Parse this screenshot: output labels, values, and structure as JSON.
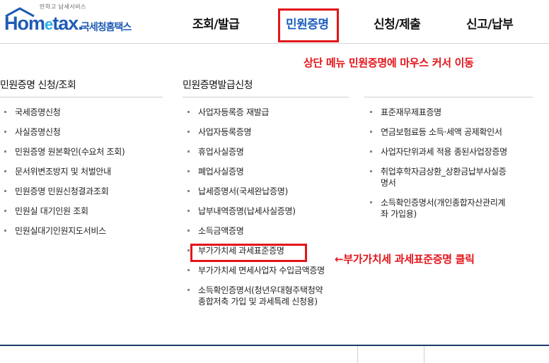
{
  "header": {
    "logo_small_text": "만하고 납세서비스",
    "logo_brand_home": "Hom",
    "logo_brand_e": "e",
    "logo_brand_tax": "tax.",
    "logo_korean_name": "국세청홈택스",
    "nav": [
      {
        "label": "조회/발급"
      },
      {
        "label": "민원증명"
      },
      {
        "label": "신청/제출"
      },
      {
        "label": "신고/납부"
      }
    ]
  },
  "annotations": {
    "top": "상단 메뉴 민원증명에 마우스 커서 이동",
    "click": "←부가가치세 과세표준증명 클릭"
  },
  "columns": {
    "col1": {
      "title": "민원증명 신청/조회",
      "items": [
        "국세증명신청",
        "사실증명신청",
        "민원증명 원본확인(수요처 조회)",
        "문서위변조방지 및 처벌안내",
        "민원증명 민원신청결과조회",
        "민원실 대기인원 조회",
        "민원실대기인원지도서비스"
      ]
    },
    "col2": {
      "title": "민원증명발급신청",
      "items": [
        "사업자등록증 재발급",
        "사업자등록증명",
        "휴업사실증명",
        "폐업사실증명",
        "납세증명서(국세완납증명)",
        "납부내역증명(납세사실증명)",
        "소득금액증명",
        "부가가치세 과세표준증명",
        "부가가치세 면세사업자 수입금액증명",
        "소득확인증명서(청년우대형주택청약",
        "종합저축 가입 및 과세특례 신청용)"
      ]
    },
    "col3": {
      "items": [
        "표준재무제표증명",
        "연금보험료등 소득·세액 공제확인서",
        "사업자단위과세 적용 종된사업장증명",
        "취업후학자금상환_상환금납부사실증",
        "명서",
        "소득확인증명서(개인종합자산관리계",
        "좌 가입용)"
      ]
    }
  },
  "colors": {
    "accent_red": "#e3141a",
    "brand_blue": "#1f5bb5",
    "active_blue": "#1d5fbd"
  }
}
